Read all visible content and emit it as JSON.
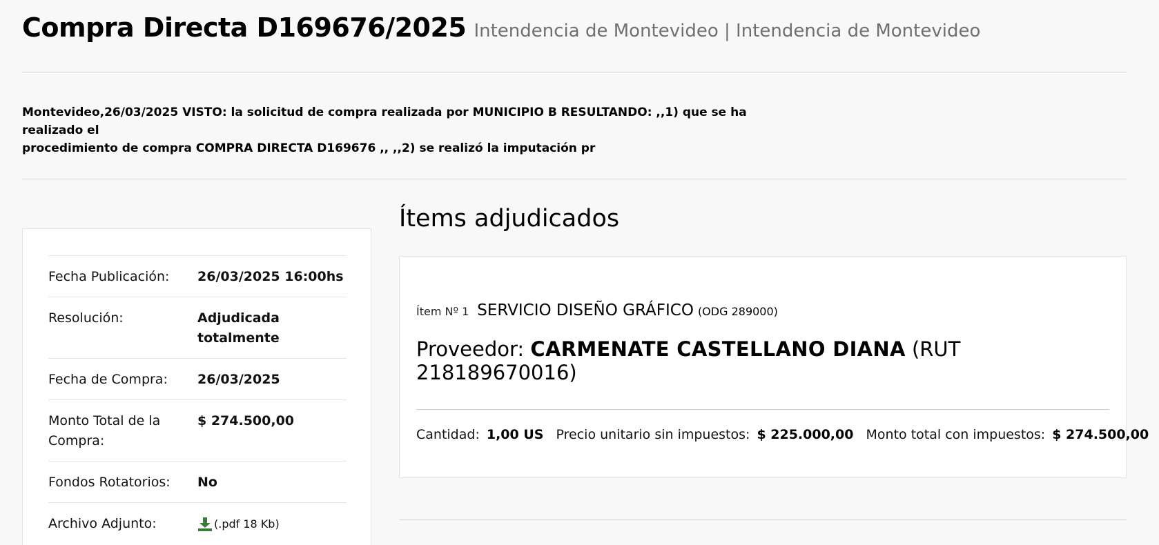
{
  "header": {
    "title": "Compra Directa D169676/2025",
    "subtitle": "Intendencia de Montevideo | Intendencia de Montevideo"
  },
  "summary": {
    "line1": "Montevideo,26/03/2025 VISTO: la solicitud de compra realizada por MUNICIPIO B RESULTANDO: ,,1) que se ha realizado el",
    "line2": "procedimiento de compra COMPRA DIRECTA D169676 ,, ,,2) se realizó la imputación pr"
  },
  "info": {
    "rows": [
      {
        "label": "Fecha Publicación:",
        "value": "26/03/2025 16:00hs"
      },
      {
        "label": "Resolución:",
        "value": "Adjudicada totalmente"
      },
      {
        "label": "Fecha de Compra:",
        "value": "26/03/2025"
      },
      {
        "label": "Monto Total de la Compra:",
        "value": "$ 274.500,00"
      },
      {
        "label": "Fondos Rotatorios:",
        "value": "No"
      }
    ],
    "attachment": {
      "label": "Archivo Adjunto:",
      "icon": "download-icon",
      "text": "(.pdf 18 Kb)",
      "icon_color": "#3a7d3a"
    }
  },
  "items": {
    "title": "Ítems adjudicados",
    "item": {
      "number": "Ítem Nº 1",
      "name": "SERVICIO DISEÑO GRÁFICO",
      "code": "(ODG 289000)",
      "provider_label": "Proveedor:",
      "provider_name": "CARMENATE CASTELLANO DIANA",
      "provider_rut": "(RUT 218189670016)",
      "quantity_label": "Cantidad:",
      "quantity_value": "1,00 US",
      "unit_price_label": "Precio unitario sin impuestos:",
      "unit_price_value": "$ 225.000,00",
      "total_label": "Monto total con impuestos:",
      "total_value": "$ 274.500,00"
    }
  }
}
